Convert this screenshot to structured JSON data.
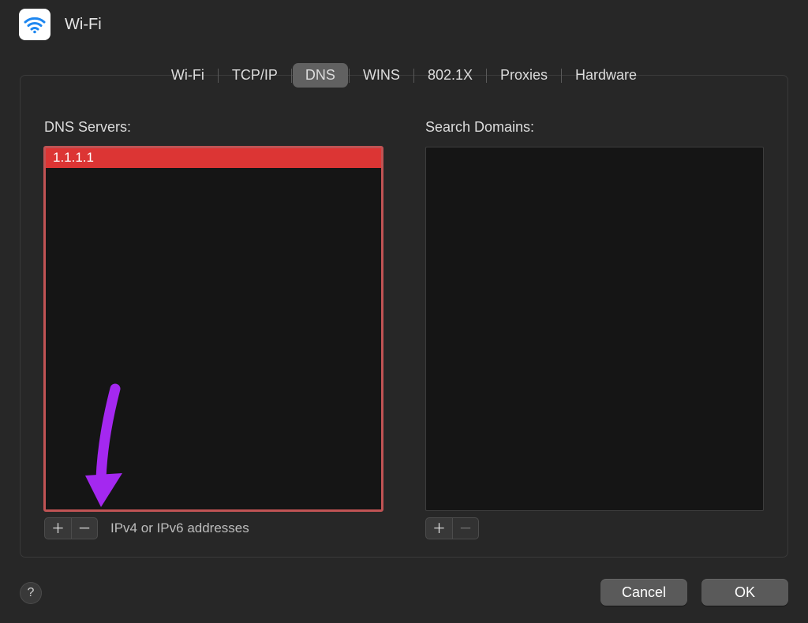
{
  "header": {
    "title": "Wi-Fi"
  },
  "tabs": {
    "items": [
      {
        "label": "Wi-Fi",
        "selected": false
      },
      {
        "label": "TCP/IP",
        "selected": false
      },
      {
        "label": "DNS",
        "selected": true
      },
      {
        "label": "WINS",
        "selected": false
      },
      {
        "label": "802.1X",
        "selected": false
      },
      {
        "label": "Proxies",
        "selected": false
      },
      {
        "label": "Hardware",
        "selected": false
      }
    ]
  },
  "dns": {
    "label": "DNS Servers:",
    "servers": [
      "1.1.1.1"
    ],
    "footer_hint": "IPv4 or IPv6 addresses"
  },
  "search_domains": {
    "label": "Search Domains:",
    "items": []
  },
  "buttons": {
    "cancel": "Cancel",
    "ok": "OK",
    "help": "?",
    "plus": "＋",
    "minus": "－"
  },
  "colors": {
    "highlight_row": "#dc3534",
    "listbox_outline": "#c05354",
    "annotation_arrow": "#a428f0"
  }
}
